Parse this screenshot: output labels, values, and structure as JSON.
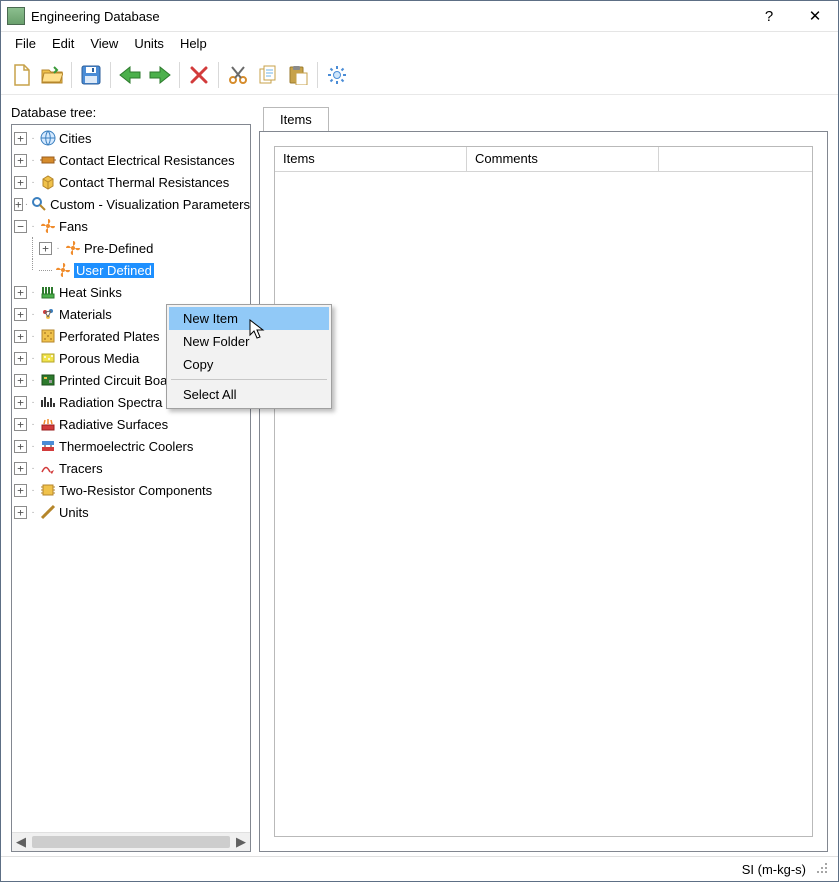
{
  "window": {
    "title": "Engineering Database"
  },
  "menubar": [
    "File",
    "Edit",
    "View",
    "Units",
    "Help"
  ],
  "toolbar_icons": [
    "new",
    "open",
    "save",
    "back",
    "forward",
    "delete",
    "cut",
    "copy",
    "paste",
    "settings"
  ],
  "tree": {
    "label": "Database tree:",
    "items": [
      {
        "label": "Cities",
        "icon": "globe",
        "exp": "+"
      },
      {
        "label": "Contact Electrical Resistances",
        "icon": "resistor-e",
        "exp": "+"
      },
      {
        "label": "Contact Thermal Resistances",
        "icon": "resistor-t",
        "exp": "+"
      },
      {
        "label": "Custom - Visualization Parameters",
        "icon": "magnify",
        "exp": "+"
      },
      {
        "label": "Fans",
        "icon": "fan-orange",
        "exp": "-",
        "children": [
          {
            "label": "Pre-Defined",
            "icon": "fan-orange",
            "exp": "+"
          },
          {
            "label": "User Defined",
            "icon": "fan-orange",
            "exp": null,
            "selected": true
          }
        ]
      },
      {
        "label": "Heat Sinks",
        "icon": "heatsink",
        "exp": "+"
      },
      {
        "label": "Materials",
        "icon": "material",
        "exp": "+"
      },
      {
        "label": "Perforated Plates",
        "icon": "perforated",
        "exp": "+"
      },
      {
        "label": "Porous Media",
        "icon": "porous",
        "exp": "+"
      },
      {
        "label": "Printed Circuit Boards",
        "icon": "pcb",
        "exp": "+"
      },
      {
        "label": "Radiation Spectra",
        "icon": "spectrum",
        "exp": "+"
      },
      {
        "label": "Radiative Surfaces",
        "icon": "radsurf",
        "exp": "+"
      },
      {
        "label": "Thermoelectric Coolers",
        "icon": "tec",
        "exp": "+"
      },
      {
        "label": "Tracers",
        "icon": "tracer",
        "exp": "+"
      },
      {
        "label": "Two-Resistor Components",
        "icon": "tworesistor",
        "exp": "+"
      },
      {
        "label": "Units",
        "icon": "units",
        "exp": "+"
      }
    ]
  },
  "right": {
    "tab": "Items",
    "columns": [
      "Items",
      "Comments"
    ]
  },
  "context_menu": {
    "items": [
      {
        "label": "New Item",
        "highlight": true
      },
      {
        "label": "New Folder"
      },
      {
        "label": "Copy"
      },
      {
        "sep": true
      },
      {
        "label": "Select All"
      }
    ]
  },
  "status": {
    "units": "SI (m-kg-s)"
  }
}
